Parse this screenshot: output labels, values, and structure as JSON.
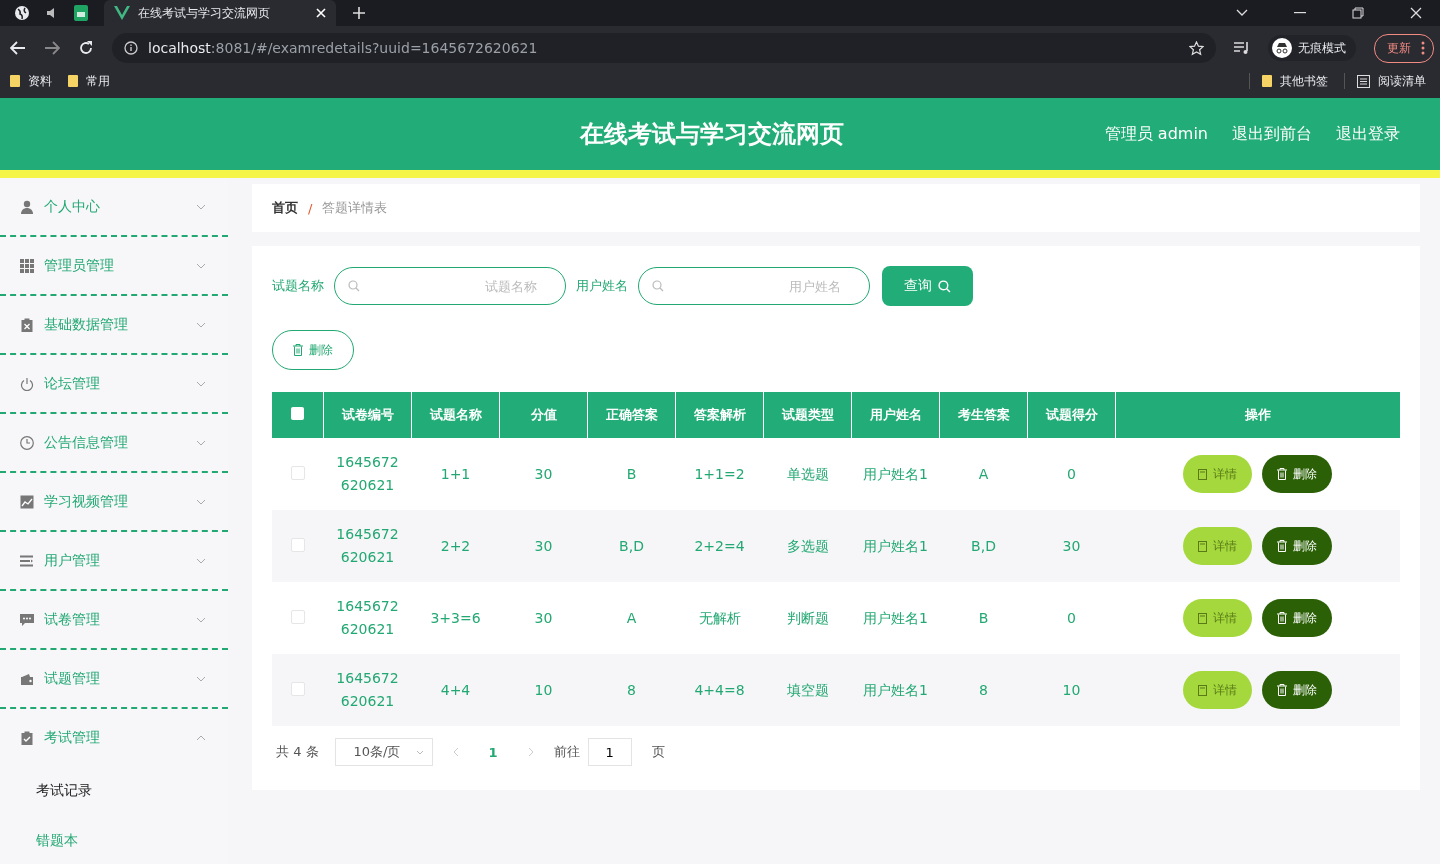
{
  "browser": {
    "tab_title": "在线考试与学习交流网页",
    "url_host": "localhost",
    "url_rest": ":8081/#/examredetails?uuid=1645672620621",
    "incognito_label": "无痕模式",
    "update_label": "更新",
    "bookmarks": [
      {
        "label": "资料"
      },
      {
        "label": "常用"
      }
    ],
    "other_bookmarks": "其他书签",
    "reading_list": "阅读清单"
  },
  "header": {
    "title": "在线考试与学习交流网页",
    "links": [
      "管理员 admin",
      "退出到前台",
      "退出登录"
    ]
  },
  "sidebar": {
    "items": [
      {
        "label": "个人中心",
        "expanded": false
      },
      {
        "label": "管理员管理",
        "expanded": false
      },
      {
        "label": "基础数据管理",
        "expanded": false
      },
      {
        "label": "论坛管理",
        "expanded": false
      },
      {
        "label": "公告信息管理",
        "expanded": false
      },
      {
        "label": "学习视频管理",
        "expanded": false
      },
      {
        "label": "用户管理",
        "expanded": false
      },
      {
        "label": "试卷管理",
        "expanded": false
      },
      {
        "label": "试题管理",
        "expanded": false
      },
      {
        "label": "考试管理",
        "expanded": true,
        "children": [
          {
            "label": "考试记录",
            "selected": true
          },
          {
            "label": "错题本",
            "selected": false
          }
        ]
      }
    ]
  },
  "breadcrumb": {
    "home": "首页",
    "separator": "/",
    "current": "答题详情表"
  },
  "search": {
    "fields": [
      {
        "label": "试题名称",
        "placeholder": "试题名称"
      },
      {
        "label": "用户姓名",
        "placeholder": "用户姓名"
      }
    ],
    "button": "查询"
  },
  "delete_button": "删除",
  "table": {
    "select_all_checked": false,
    "columns": [
      "试卷编号",
      "试题名称",
      "分值",
      "正确答案",
      "答案解析",
      "试题类型",
      "用户姓名",
      "考生答案",
      "试题得分",
      "操作"
    ],
    "rows": [
      {
        "checked": false,
        "cells": [
          "1645672620621",
          "1+1",
          "30",
          "B",
          "1+1=2",
          "单选题",
          "用户姓名1",
          "A",
          "0"
        ],
        "actions": [
          "详情",
          "删除"
        ]
      },
      {
        "checked": false,
        "cells": [
          "1645672620621",
          "2+2",
          "30",
          "B,D",
          "2+2=4",
          "多选题",
          "用户姓名1",
          "B,D",
          "30"
        ],
        "actions": [
          "详情",
          "删除"
        ]
      },
      {
        "checked": false,
        "cells": [
          "1645672620621",
          "3+3=6",
          "30",
          "A",
          "无解析",
          "判断题",
          "用户姓名1",
          "B",
          "0"
        ],
        "actions": [
          "详情",
          "删除"
        ]
      },
      {
        "checked": false,
        "cells": [
          "1645672620621",
          "4+4",
          "10",
          "8",
          "4+4=8",
          "填空题",
          "用户姓名1",
          "8",
          "10"
        ],
        "actions": [
          "详情",
          "删除"
        ]
      }
    ]
  },
  "pagination": {
    "total": "共 4 条",
    "page_size": "10条/页",
    "pages": [
      {
        "label": "1",
        "selected": true
      }
    ],
    "goto_label": "前往",
    "goto_value": "1",
    "page_suffix": "页"
  }
}
